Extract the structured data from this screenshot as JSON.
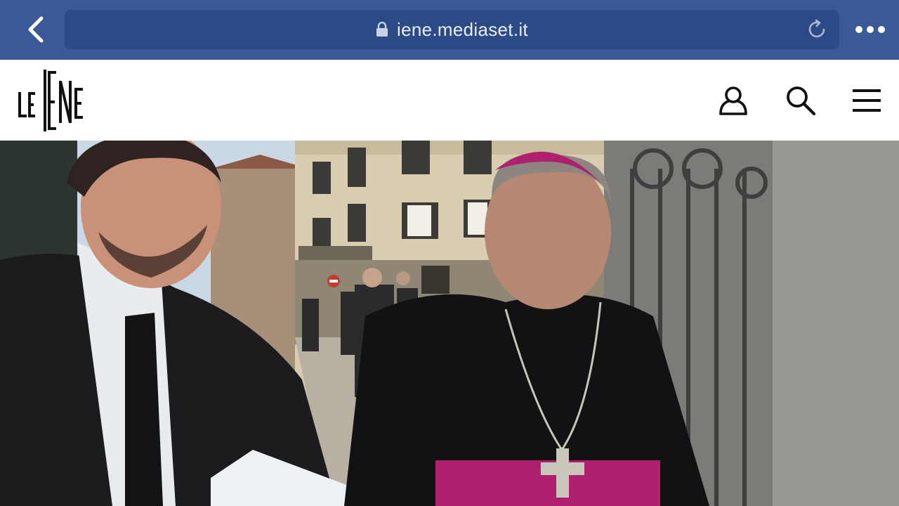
{
  "browser": {
    "url": "iene.mediaset.it",
    "accent": "#3b5998"
  },
  "site": {
    "name": "Le Iene",
    "nav_icons": [
      "user-icon",
      "search-icon",
      "menu-icon"
    ]
  },
  "hero": {
    "kind": "video-frame",
    "colors": {
      "zucchetto": "#b0206f",
      "facade": "#d8cdb0",
      "sky": "#c9d8e4"
    }
  }
}
